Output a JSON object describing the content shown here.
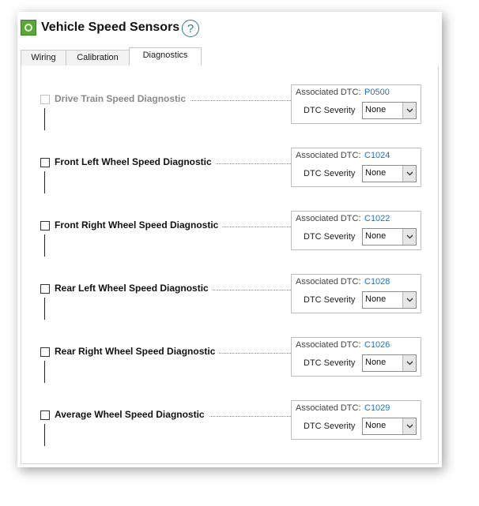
{
  "header": {
    "icon": "app-logo-icon",
    "title": "Vehicle Speed Sensors",
    "help_icon": "?"
  },
  "tabs": [
    {
      "label": "Wiring",
      "active": false
    },
    {
      "label": "Calibration",
      "active": false
    },
    {
      "label": "Diagnostics",
      "active": true
    }
  ],
  "diagnostics": [
    {
      "label": "Drive Train Speed Diagnostic",
      "enabled": false,
      "checked": false,
      "dtc_label": "Associated DTC:",
      "dtc_code": "P0500",
      "severity_label": "DTC Severity",
      "severity": "None"
    },
    {
      "label": "Front Left Wheel Speed Diagnostic",
      "enabled": true,
      "checked": false,
      "dtc_label": "Associated DTC:",
      "dtc_code": "C1024",
      "severity_label": "DTC Severity",
      "severity": "None"
    },
    {
      "label": "Front Right Wheel Speed Diagnostic",
      "enabled": true,
      "checked": false,
      "dtc_label": "Associated DTC:",
      "dtc_code": "C1022",
      "severity_label": "DTC Severity",
      "severity": "None"
    },
    {
      "label": "Rear Left Wheel Speed Diagnostic",
      "enabled": true,
      "checked": false,
      "dtc_label": "Associated DTC:",
      "dtc_code": "C1028",
      "severity_label": "DTC Severity",
      "severity": "None"
    },
    {
      "label": "Rear Right Wheel Speed Diagnostic",
      "enabled": true,
      "checked": false,
      "dtc_label": "Associated DTC:",
      "dtc_code": "C1026",
      "severity_label": "DTC Severity",
      "severity": "None"
    },
    {
      "label": "Average Wheel Speed Diagnostic",
      "enabled": true,
      "checked": false,
      "dtc_label": "Associated DTC:",
      "dtc_code": "C1029",
      "severity_label": "DTC Severity",
      "severity": "None"
    }
  ],
  "colors": {
    "accent": "#2c7a86",
    "dtc_link": "#1e73be",
    "logo": "#5aa83a"
  }
}
